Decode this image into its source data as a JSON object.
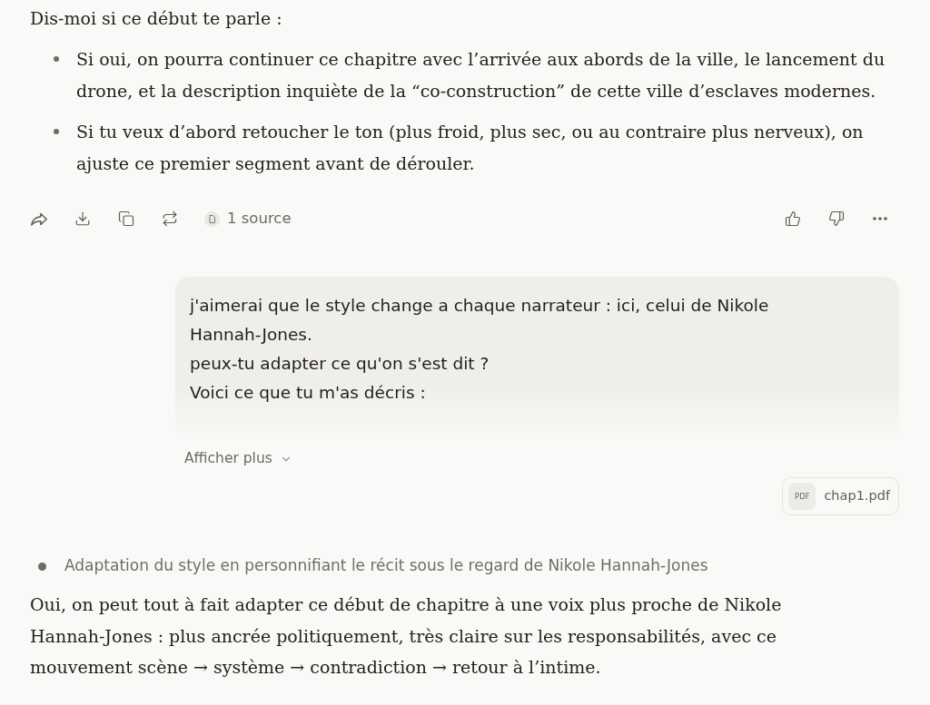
{
  "reply_top": {
    "intro": "Dis-moi si ce début te parle :",
    "bullets": [
      "Si oui, on pourra continuer ce chapitre avec l’arrivée aux abords de la ville, le lancement du drone, et la description inquiète de la “co-construction” de cette ville d’esclaves modernes.",
      "Si tu veux d’abord retoucher le ton (plus froid, plus sec, ou au contraire plus nerveux), on ajuste ce premier segment avant de dérouler."
    ]
  },
  "action_bar": {
    "source_label": "1 source"
  },
  "user_message": {
    "text": "j'aimerai que le style change a chaque narrateur : ici, celui de Nikole Hannah-Jones.\npeux-tu adapter ce qu'on s'est dit ?\nVoici ce que tu m'as décris :",
    "show_more": "Afficher plus",
    "attachment": {
      "badge": "PDF",
      "name": "chap1.pdf"
    }
  },
  "reply": {
    "thought": "Adaptation du style en personnifiant le récit sous le regard de Nikole Hannah-Jones",
    "paragraph": "Oui, on peut tout à fait adapter ce début de chapitre à une voix plus proche de Nikole Hannah-Jones : plus ancrée politiquement, très claire sur les responsabilités, avec ce mouvement scène → système → contradiction → retour à l’intime."
  }
}
